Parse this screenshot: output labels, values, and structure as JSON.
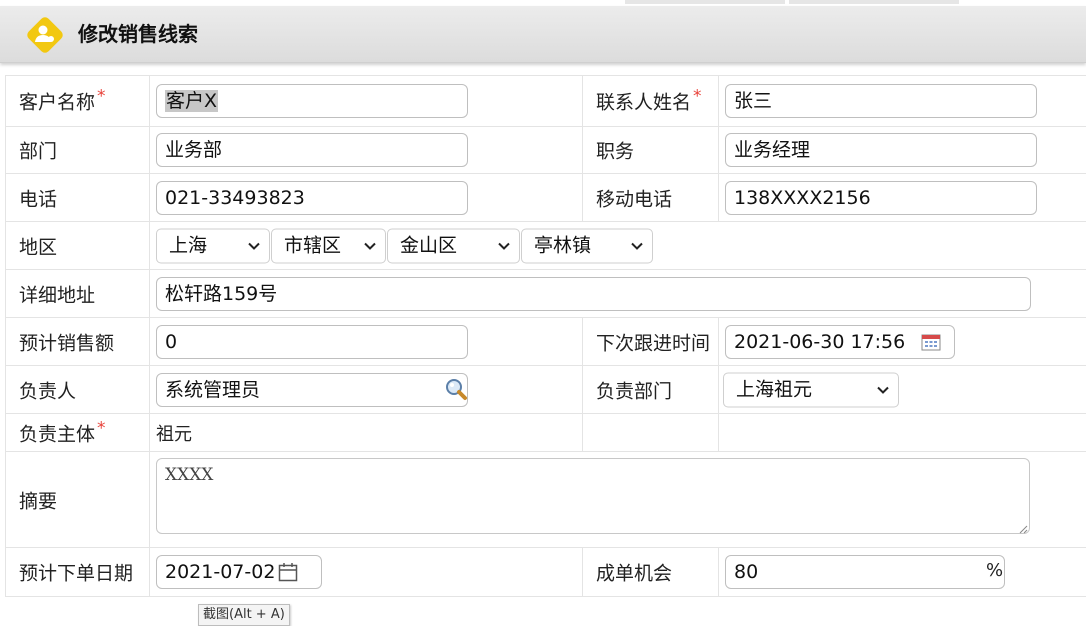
{
  "header": {
    "title": "修改销售线索"
  },
  "icons": {
    "header_logo": "user-badge-icon",
    "search": "magnifier-icon",
    "calendar": "calendar-icon",
    "chevron": "chevron-down-icon"
  },
  "colors": {
    "required": "#e8443c",
    "logo_yellow": "#f2c811"
  },
  "form": {
    "customer_name": {
      "label": "客户名称",
      "value": "客户X",
      "required": "*"
    },
    "contact_name": {
      "label": "联系人姓名",
      "value": "张三",
      "required": "*"
    },
    "department": {
      "label": "部门",
      "value": "业务部"
    },
    "position": {
      "label": "职务",
      "value": "业务经理"
    },
    "phone": {
      "label": "电话",
      "value": "021-33493823"
    },
    "mobile": {
      "label": "移动电话",
      "value": "138XXXX2156"
    },
    "region": {
      "label": "地区",
      "province": "上海",
      "city": "市辖区",
      "district": "金山区",
      "town": "亭林镇"
    },
    "address": {
      "label": "详细地址",
      "value": "松轩路159号"
    },
    "expected_sales": {
      "label": "预计销售额",
      "value": "0"
    },
    "next_followup": {
      "label": "下次跟进时间",
      "value": "2021-06-30 17:56"
    },
    "owner": {
      "label": "负责人",
      "value": "系统管理员"
    },
    "owner_dept": {
      "label": "负责部门",
      "value": "上海祖元"
    },
    "entity": {
      "label": "负责主体",
      "value": "祖元",
      "required": "*"
    },
    "summary": {
      "label": "摘要",
      "value": "XXXX"
    },
    "order_date": {
      "label": "预计下单日期",
      "value": "2021-07-02"
    },
    "deal_chance": {
      "label": "成单机会",
      "value": "80",
      "unit": "%"
    }
  },
  "tooltip": {
    "text": "截图(Alt + A)"
  }
}
